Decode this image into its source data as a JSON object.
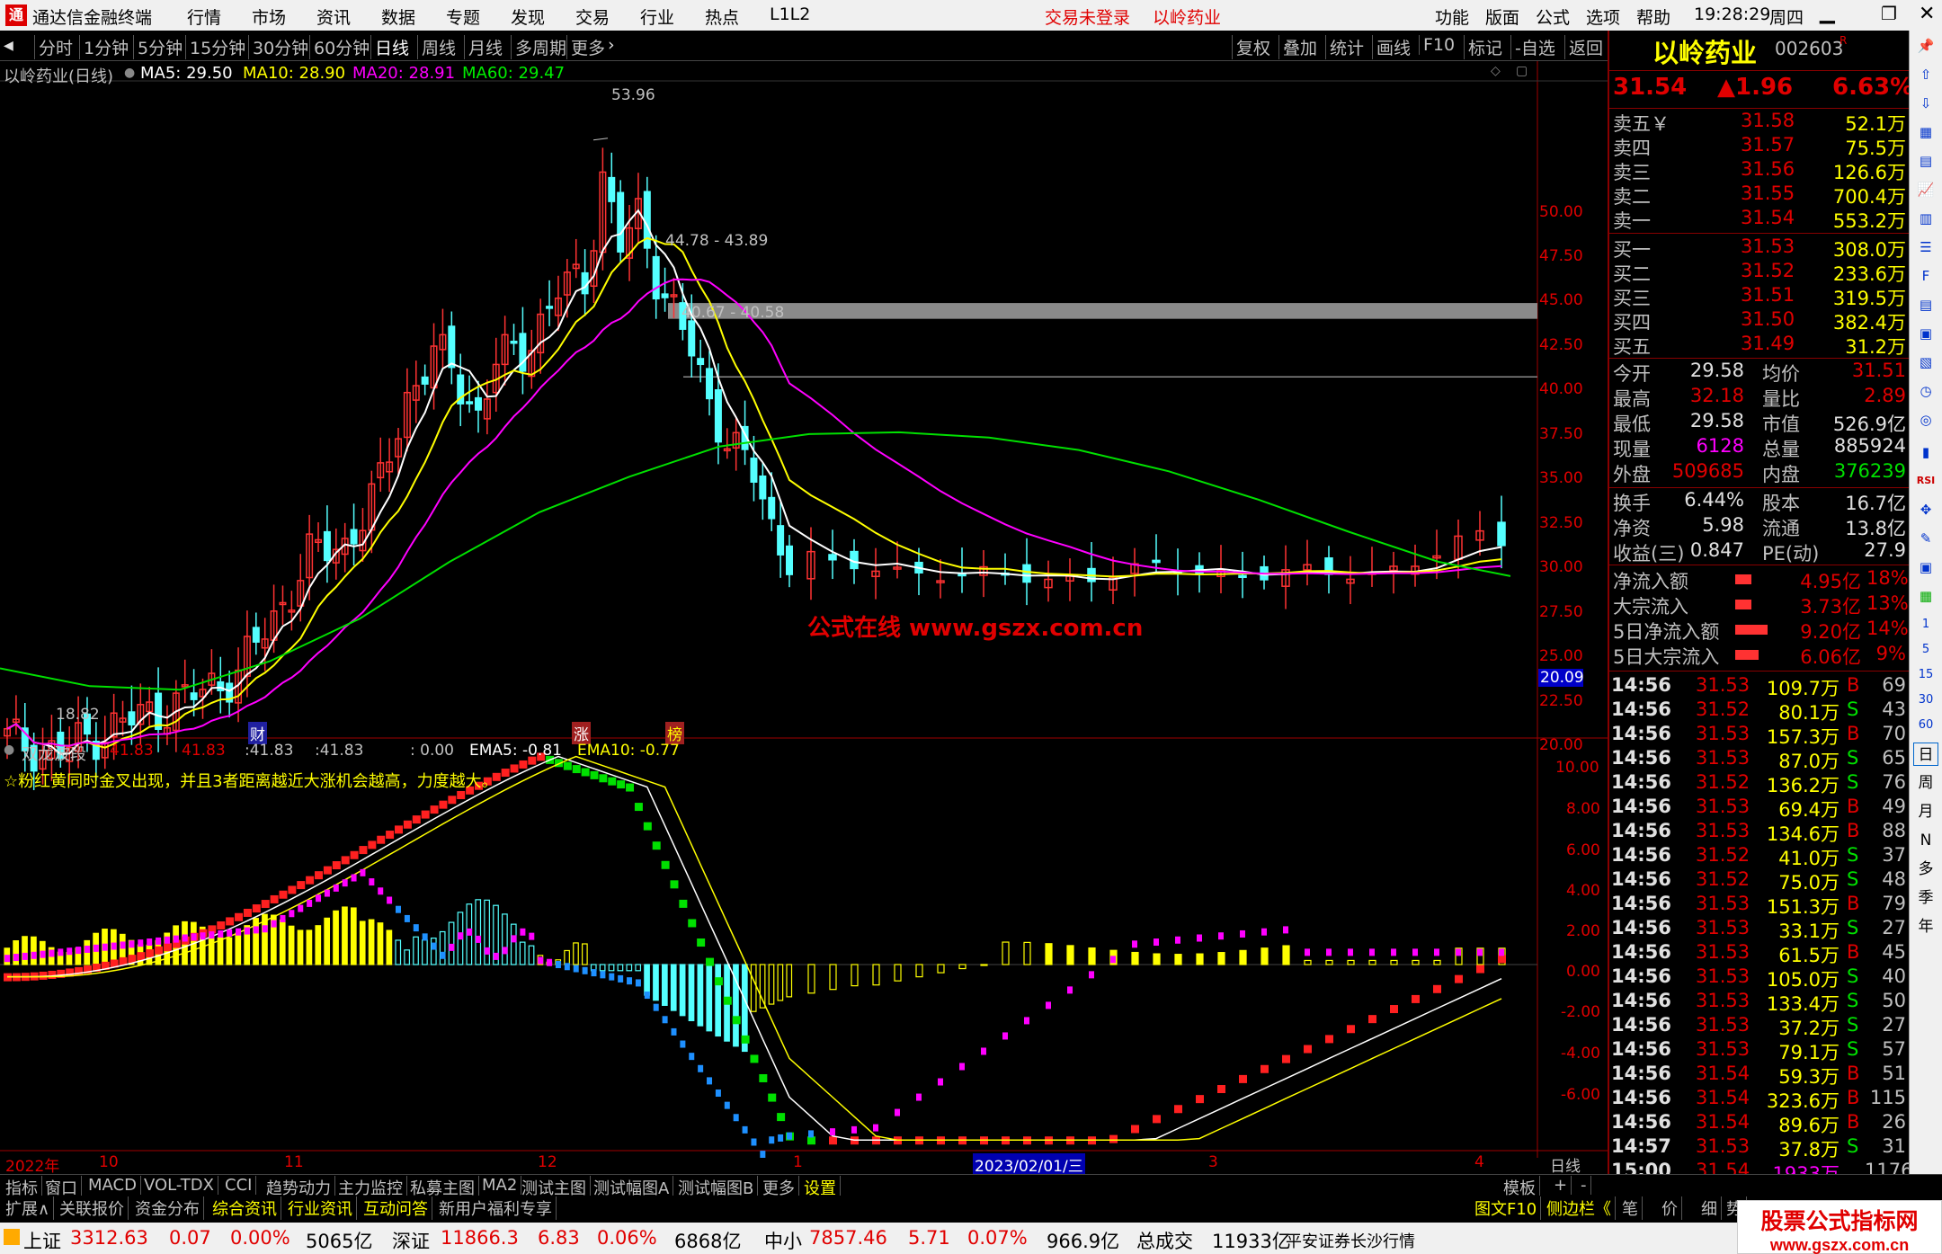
{
  "titlebar": {
    "title": "通达信金融终端",
    "menu": [
      "行情",
      "市场",
      "资讯",
      "数据",
      "专题",
      "发现",
      "交易",
      "行业",
      "热点",
      "L1L2"
    ],
    "login": "交易未登录",
    "stock": "以岭药业",
    "right_menu": [
      "功能",
      "版面",
      "公式",
      "选项",
      "帮助"
    ],
    "time": "19:28:29",
    "weekday": "周四"
  },
  "toolbar": {
    "periods": [
      "分时",
      "1分钟",
      "5分钟",
      "15分钟",
      "30分钟",
      "60分钟",
      "日线",
      "周线",
      "月线",
      "多周期",
      "更多"
    ],
    "active": "日线",
    "actions": [
      "复权",
      "叠加",
      "统计",
      "画线",
      "F10",
      "标记",
      "-自选",
      "返回"
    ]
  },
  "chart": {
    "header": {
      "name": "以岭药业(日线)",
      "ma5": "MA5: 29.50",
      "ma10": "MA10: 28.90",
      "ma20": "MA20: 28.91",
      "ma60": "MA60: 29.47"
    },
    "price_axis": [
      "50.00",
      "47.50",
      "45.00",
      "42.50",
      "40.00",
      "37.50",
      "35.00",
      "32.50",
      "30.00",
      "27.50",
      "25.00",
      "22.50",
      "20.00"
    ],
    "low_label": "18.82",
    "high_label": "53.96",
    "gap1": "44.78 - 43.89",
    "gap2": "40.67 - 40.58",
    "watermark": "公式在线  www.gszx.com.cn",
    "price_tag": "20.09",
    "markers": [
      "财",
      "涨",
      "榜"
    ],
    "indicator": {
      "name": "双龙波段",
      "v1": "41.83",
      "v2": "41.83",
      "v3": ":41.83",
      "v4": ":41.83",
      "v5": ": 0.00",
      "ema5": "EMA5: -0.81",
      "ema10": "EMA10: -0.77",
      "note": "☆粉红黄同时金叉出现，并且3者距离越近大涨机会越高，力度越大。"
    },
    "ind_axis": [
      "10.00",
      "8.00",
      "6.00",
      "4.00",
      "2.00",
      "0.00",
      "-2.00",
      "-4.00",
      "-6.00"
    ],
    "date_axis": [
      "2022年",
      "10",
      "11",
      "12",
      "1",
      "2023/02/01/三",
      "3",
      "4"
    ],
    "period_label": "日线",
    "colors": {
      "up": "#ff3232",
      "down": "#54ffff",
      "ma5": "#ffffff",
      "ma10": "#ffff00",
      "ma20": "#ff00ff",
      "ma60": "#00e000"
    }
  },
  "chart_data": {
    "type": "candlestick",
    "ylim": [
      18,
      55
    ],
    "ma60": [
      [
        0,
        24.2
      ],
      [
        100,
        23.2
      ],
      [
        200,
        23.0
      ],
      [
        300,
        24.6
      ],
      [
        400,
        27.0
      ],
      [
        500,
        30.2
      ],
      [
        600,
        33.0
      ],
      [
        700,
        35.0
      ],
      [
        800,
        36.7
      ],
      [
        900,
        37.4
      ],
      [
        1000,
        37.5
      ],
      [
        1100,
        37.2
      ],
      [
        1200,
        36.5
      ],
      [
        1300,
        35.3
      ],
      [
        1400,
        33.7
      ],
      [
        1500,
        31.9
      ],
      [
        1600,
        30.2
      ],
      [
        1680,
        29.4
      ]
    ]
  },
  "quote": {
    "name": "以岭药业",
    "code": "002603",
    "tag": "R",
    "price": "31.54",
    "change": "▲1.96",
    "pct": "6.63%",
    "asks": [
      [
        "卖五￥",
        "31.58",
        "52.1万"
      ],
      [
        "卖四",
        "31.57",
        "75.5万"
      ],
      [
        "卖三",
        "31.56",
        "126.6万"
      ],
      [
        "卖二",
        "31.55",
        "700.4万"
      ],
      [
        "卖一",
        "31.54",
        "553.2万"
      ]
    ],
    "bids": [
      [
        "买一",
        "31.53",
        "308.0万"
      ],
      [
        "买二",
        "31.52",
        "233.6万"
      ],
      [
        "买三",
        "31.51",
        "319.5万"
      ],
      [
        "买四",
        "31.50",
        "382.4万"
      ],
      [
        "买五",
        "31.49",
        "31.2万"
      ]
    ],
    "stats": [
      [
        "今开",
        "29.58",
        "均价",
        "31.51"
      ],
      [
        "最高",
        "32.18",
        "量比",
        "2.89"
      ],
      [
        "最低",
        "29.58",
        "市值",
        "526.9亿"
      ],
      [
        "现量",
        "6128",
        "总量",
        "885924"
      ],
      [
        "外盘",
        "509685",
        "内盘",
        "376239"
      ]
    ],
    "fin": [
      [
        "换手",
        "6.44%",
        "股本",
        "16.7亿"
      ],
      [
        "净资",
        "5.98",
        "流通",
        "13.8亿"
      ],
      [
        "收益(三)",
        "0.847",
        "PE(动)",
        "27.9"
      ]
    ],
    "flows": [
      [
        "净流入额",
        "4.95亿",
        "18%"
      ],
      [
        "大宗流入",
        "3.73亿",
        "13%"
      ],
      [
        "5日净流入额",
        "9.20亿",
        "14%"
      ],
      [
        "5日大宗流入",
        "6.06亿",
        "9%"
      ]
    ],
    "ticks": [
      [
        "14:56",
        "31.53",
        "109.7万",
        "B",
        "69"
      ],
      [
        "14:56",
        "31.52",
        "80.1万",
        "S",
        "43"
      ],
      [
        "14:56",
        "31.53",
        "157.3万",
        "B",
        "70"
      ],
      [
        "14:56",
        "31.53",
        "87.0万",
        "S",
        "65"
      ],
      [
        "14:56",
        "31.52",
        "136.2万",
        "S",
        "76"
      ],
      [
        "14:56",
        "31.53",
        "69.4万",
        "B",
        "49"
      ],
      [
        "14:56",
        "31.53",
        "134.6万",
        "B",
        "88"
      ],
      [
        "14:56",
        "31.52",
        "41.0万",
        "S",
        "37"
      ],
      [
        "14:56",
        "31.52",
        "75.0万",
        "S",
        "48"
      ],
      [
        "14:56",
        "31.53",
        "151.3万",
        "B",
        "79"
      ],
      [
        "14:56",
        "31.53",
        "33.1万",
        "S",
        "27"
      ],
      [
        "14:56",
        "31.53",
        "61.5万",
        "B",
        "45"
      ],
      [
        "14:56",
        "31.53",
        "105.0万",
        "S",
        "40"
      ],
      [
        "14:56",
        "31.53",
        "133.4万",
        "S",
        "50"
      ],
      [
        "14:56",
        "31.53",
        "37.2万",
        "S",
        "27"
      ],
      [
        "14:56",
        "31.53",
        "79.1万",
        "S",
        "57"
      ],
      [
        "14:56",
        "31.54",
        "59.3万",
        "B",
        "51"
      ],
      [
        "14:56",
        "31.54",
        "323.6万",
        "B",
        "115"
      ],
      [
        "14:56",
        "31.54",
        "89.6万",
        "B",
        "26"
      ],
      [
        "14:57",
        "31.53",
        "37.8万",
        "S",
        "31"
      ],
      [
        "15:00",
        "31.54",
        "1933万",
        "",
        "1176"
      ]
    ]
  },
  "sidestrip": {
    "labels": [
      "日",
      "周",
      "月",
      "N",
      "多",
      "季",
      "年"
    ]
  },
  "bottomtabs": [
    "指标",
    "窗口",
    "MACD",
    "VOL-TDX",
    "CCI",
    "趋势动力",
    "主力监控",
    "私募主图",
    "MA2",
    "测试主图",
    "测试幅图A",
    "测试幅图B",
    "更多",
    "设置"
  ],
  "bottomright": [
    "模板",
    "+",
    "-"
  ],
  "bottomtabs2": [
    "扩展∧",
    "关联报价",
    "资金分布",
    "综合资讯",
    "行业资讯",
    "互动问答",
    "新用户福利专享"
  ],
  "bottomtabs2right": [
    "图文F10",
    "侧边栏《",
    "笔",
    "价",
    "细",
    "势"
  ],
  "status": {
    "sh_label": "上证",
    "sh": "3312.63",
    "sh_chg": "0.07",
    "sh_pct": "0.00%",
    "sh_amt": "5065亿",
    "sz_label": "深证",
    "sz": "11866.3",
    "sz_chg": "6.83",
    "sz_pct": "0.06%",
    "sz_amt": "6868亿",
    "zx_label": "中小",
    "zx": "7857.46",
    "zx_chg": "5.71",
    "zx_pct": "0.07%",
    "zx_amt": "966.9亿",
    "total_label": "总成交",
    "total": "11933亿",
    "broker": "平安证券长沙行情",
    "brand": "股票公式指标网",
    "brand_url": "www.gszx.com.cn"
  }
}
